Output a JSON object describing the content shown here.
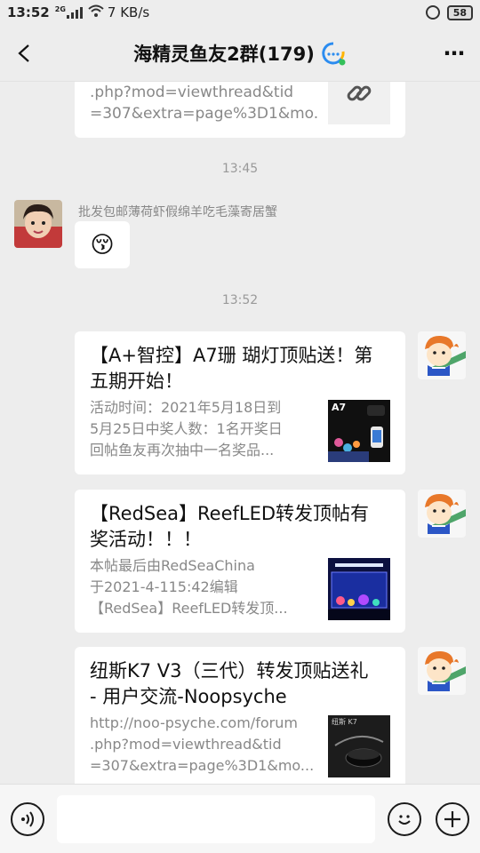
{
  "status_bar": {
    "time": "13:52",
    "network": "2G",
    "speed": "7 KB/s",
    "battery": "58"
  },
  "header": {
    "back_icon": "chevron-left-icon",
    "title": "海精灵鱼友2群(179)",
    "title_icon": "qq-group-icon",
    "more_icon": "more-dots-icon"
  },
  "messages": {
    "top_card": {
      "desc_lines": [
        ".php?mod=viewthread&tid",
        "=307&extra=page%3D1&mo..."
      ],
      "thumb_icon": "link-icon"
    },
    "time_1": "13:45",
    "incoming": {
      "sender": "批发包邮薄荷虾假绵羊吃毛藻寄居蟹",
      "emoji": "😚"
    },
    "time_2": "13:52",
    "cards": [
      {
        "title_lines": [
          "【A+智控】A7珊 瑚灯顶贴送！第",
          "五期开始！"
        ],
        "desc_lines": [
          "活动时间：2021年5月18日到",
          "5月25日中奖人数：1名开奖日",
          "回帖鱼友再次抽中一名奖品..."
        ],
        "thumb_label": "A7"
      },
      {
        "title_lines": [
          "【RedSea】ReefLED转发顶帖有",
          "奖活动！！！"
        ],
        "desc_lines": [
          "本帖最后由RedSeaChina",
          "于2021-4-115:42编辑",
          "【RedSea】ReefLED转发顶..."
        ]
      },
      {
        "title_lines": [
          "纽斯K7 V3（三代）转发顶贴送礼",
          "- 用户交流-Noopsyche"
        ],
        "desc_lines": [
          "http://noo-psyche.com/forum",
          ".php?mod=viewthread&tid",
          "=307&extra=page%3D1&mo..."
        ],
        "thumb_label": "纽斯 K7"
      }
    ]
  },
  "input_bar": {
    "voice_icon": "voice-icon",
    "emoji_icon": "emoji-icon",
    "plus_icon": "plus-icon",
    "input_value": ""
  }
}
